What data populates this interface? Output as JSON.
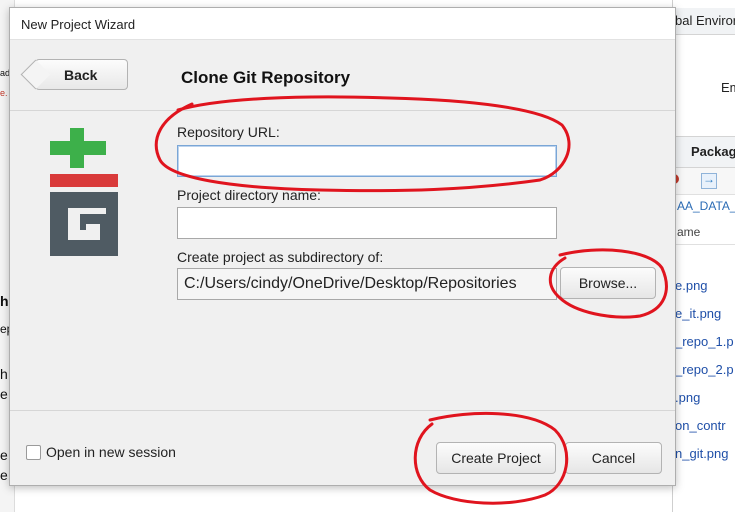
{
  "background": {
    "left_fragments": [
      "ad",
      "e.",
      "h",
      "ep",
      "h",
      "e",
      "e",
      "e"
    ],
    "right_panel": {
      "env_tab": "bal Enviror",
      "env_text": "Em",
      "packages_tab": "Packag",
      "path_link": "AA_DATA_",
      "column_header": "ame",
      "files": [
        "e.png",
        "e_it.png",
        "_repo_1.p",
        "_repo_2.p",
        ".png",
        "on_contr",
        "n_git.png"
      ]
    }
  },
  "dialog": {
    "window_title": "New Project Wizard",
    "back_label": "Back",
    "page_title": "Clone Git Repository",
    "repo_url": {
      "label": "Repository URL:",
      "value": ""
    },
    "project_dir": {
      "label": "Project directory name:",
      "value": ""
    },
    "subdir": {
      "label": "Create project as subdirectory of:",
      "value": "C:/Users/cindy/OneDrive/Desktop/Repositories",
      "browse_label": "Browse..."
    },
    "open_new_session_label": "Open in new session",
    "open_new_session_checked": false,
    "create_label": "Create Project",
    "cancel_label": "Cancel"
  },
  "colors": {
    "annotation_red": "#e0141e",
    "git_green": "#3db04a",
    "git_red": "#d93a3a",
    "git_gray": "#4f5b63",
    "link_blue": "#1f4fa8"
  },
  "icons": [
    "git-logo-icon",
    "back-arrow-icon",
    "checkbox-icon"
  ]
}
